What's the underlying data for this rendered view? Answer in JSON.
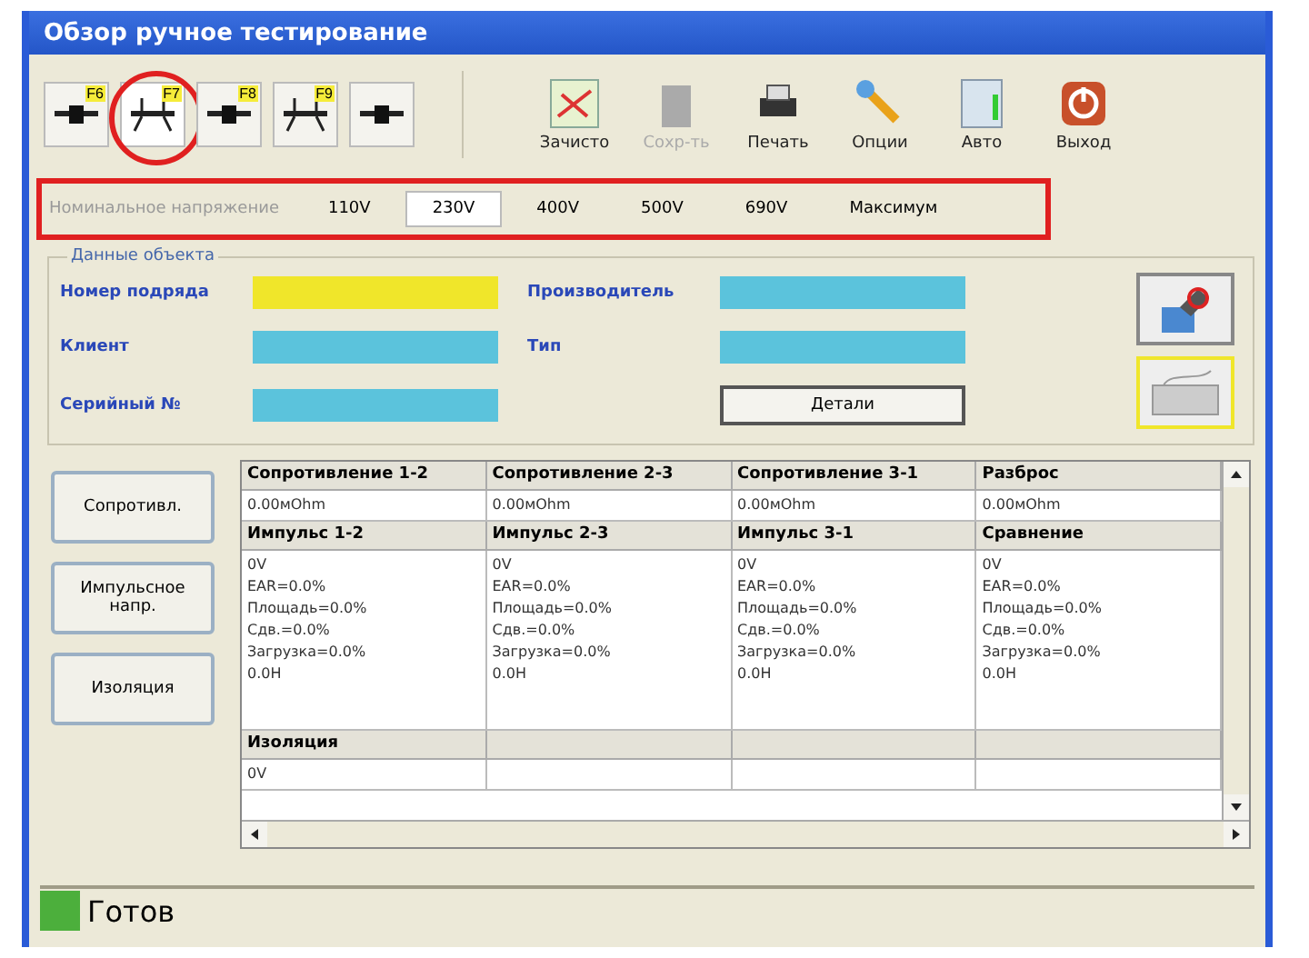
{
  "window": {
    "title": "Обзор ручное тестирование"
  },
  "toolbar": {
    "modes": [
      {
        "key": "F6",
        "selected": false,
        "circled": false
      },
      {
        "key": "F7",
        "selected": true,
        "circled": true
      },
      {
        "key": "F8",
        "selected": false,
        "circled": false
      },
      {
        "key": "F9",
        "selected": false,
        "circled": false
      },
      {
        "selected": false,
        "circled": false
      }
    ],
    "actions": [
      {
        "kind": "clear",
        "label": "Зачисто",
        "disabled": false
      },
      {
        "kind": "save",
        "label": "Сохр-ть",
        "disabled": true
      },
      {
        "kind": "print",
        "label": "Печать",
        "disabled": false
      },
      {
        "kind": "options",
        "label": "Опции",
        "disabled": false
      },
      {
        "kind": "auto",
        "label": "Авто",
        "disabled": false
      },
      {
        "kind": "exit",
        "label": "Выход",
        "disabled": false
      }
    ]
  },
  "voltage_bar": {
    "label": "Номинальное напряжение",
    "highlighted": true,
    "options": [
      {
        "label": "110V",
        "selected": false
      },
      {
        "label": "230V",
        "selected": true
      },
      {
        "label": "400V",
        "selected": false
      },
      {
        "label": "500V",
        "selected": false
      },
      {
        "label": "690V",
        "selected": false
      },
      {
        "label": "Максимум",
        "selected": false
      }
    ]
  },
  "object_data": {
    "title": "Данные объекта",
    "fields": [
      {
        "label": "Номер подряда",
        "color": "#f0e62a"
      },
      {
        "label": "Производитель",
        "color": "#5bc3dc"
      },
      {
        "label": "Клиент",
        "color": "#5bc3dc"
      },
      {
        "label": "Тип",
        "color": "#5bc3dc"
      },
      {
        "label": "Серийный №",
        "color": "#5bc3dc"
      }
    ],
    "details_button": "Детали",
    "keyboard_highlighted": true
  },
  "side_buttons": [
    "Сопротивл.",
    "Импульсное напр.",
    "Изоляция"
  ],
  "table": {
    "rows": [
      {
        "kind": "header",
        "cells": [
          "Сопротивление 1-2",
          "Сопротивление 2-3",
          "Сопротивление 3-1",
          "Разброс"
        ]
      },
      {
        "kind": "value",
        "cells": [
          [
            "0.00мОhm"
          ],
          [
            "0.00мОhm"
          ],
          [
            "0.00мОhm"
          ],
          [
            "0.00мОhm"
          ]
        ]
      },
      {
        "kind": "header",
        "cells": [
          "Импульс 1-2",
          "Импульс 2-3",
          "Импульс 3-1",
          "Сравнение"
        ]
      },
      {
        "kind": "value",
        "cells": [
          [
            "0V",
            "EAR=0.0%",
            "Площадь=0.0%",
            "Сдв.=0.0%",
            "Загрузка=0.0%",
            "0.0H"
          ],
          [
            "0V",
            "EAR=0.0%",
            "Площадь=0.0%",
            "Сдв.=0.0%",
            "Загрузка=0.0%",
            "0.0H"
          ],
          [
            "0V",
            "EAR=0.0%",
            "Площадь=0.0%",
            "Сдв.=0.0%",
            "Загрузка=0.0%",
            "0.0H"
          ],
          [
            "0V",
            "EAR=0.0%",
            "Площадь=0.0%",
            "Сдв.=0.0%",
            "Загрузка=0.0%",
            "0.0H"
          ]
        ]
      },
      {
        "kind": "header",
        "cells": [
          "Изоляция"
        ]
      },
      {
        "kind": "value",
        "cells": [
          [
            "0V"
          ]
        ]
      }
    ]
  },
  "status_bar": {
    "text": "Готов",
    "color": "#4caf3c"
  }
}
